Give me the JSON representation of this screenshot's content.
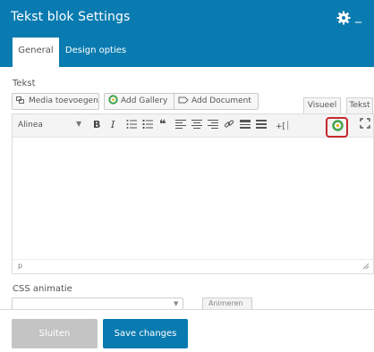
{
  "header": {
    "title": "Tekst blok Settings",
    "settings_icon": "gear-icon",
    "minimize_label": "_",
    "tabs": [
      {
        "label": "General",
        "active": true
      },
      {
        "label": "Design opties",
        "active": false
      }
    ]
  },
  "tekst_field": {
    "label": "Tekst",
    "media_buttons": [
      {
        "label": "Media toevoegen",
        "icon": "media-icon"
      },
      {
        "label": "Add Gallery",
        "icon": "gallery-icon"
      },
      {
        "label": "Add Document",
        "icon": "document-icon"
      }
    ],
    "editor_tabs": [
      {
        "label": "Visueel",
        "active": true
      },
      {
        "label": "Tekst",
        "active": false
      }
    ],
    "toolbar": {
      "format_select": "Alinea",
      "buttons": [
        "bold",
        "italic",
        "bulleted-list",
        "numbered-list",
        "blockquote",
        "align-left",
        "align-center",
        "align-right",
        "link",
        "insert-more",
        "toolbar-toggle",
        "insert-shortcode",
        "gallery-shortcode",
        "fullscreen"
      ],
      "bold_label": "B",
      "italic_label": "I",
      "shortcode_label": "+[",
      "highlighted_button": "gallery-shortcode"
    },
    "statusbar_path": "p"
  },
  "css_animation": {
    "label": "CSS animatie",
    "select_value": "",
    "button_label": "Animeren"
  },
  "footer": {
    "close_label": "Sluiten",
    "save_label": "Save changes"
  },
  "colors": {
    "brand_blue": "#0a7bb0",
    "highlight_red": "#c4292c",
    "disabled_gray": "#c4c4c4"
  }
}
